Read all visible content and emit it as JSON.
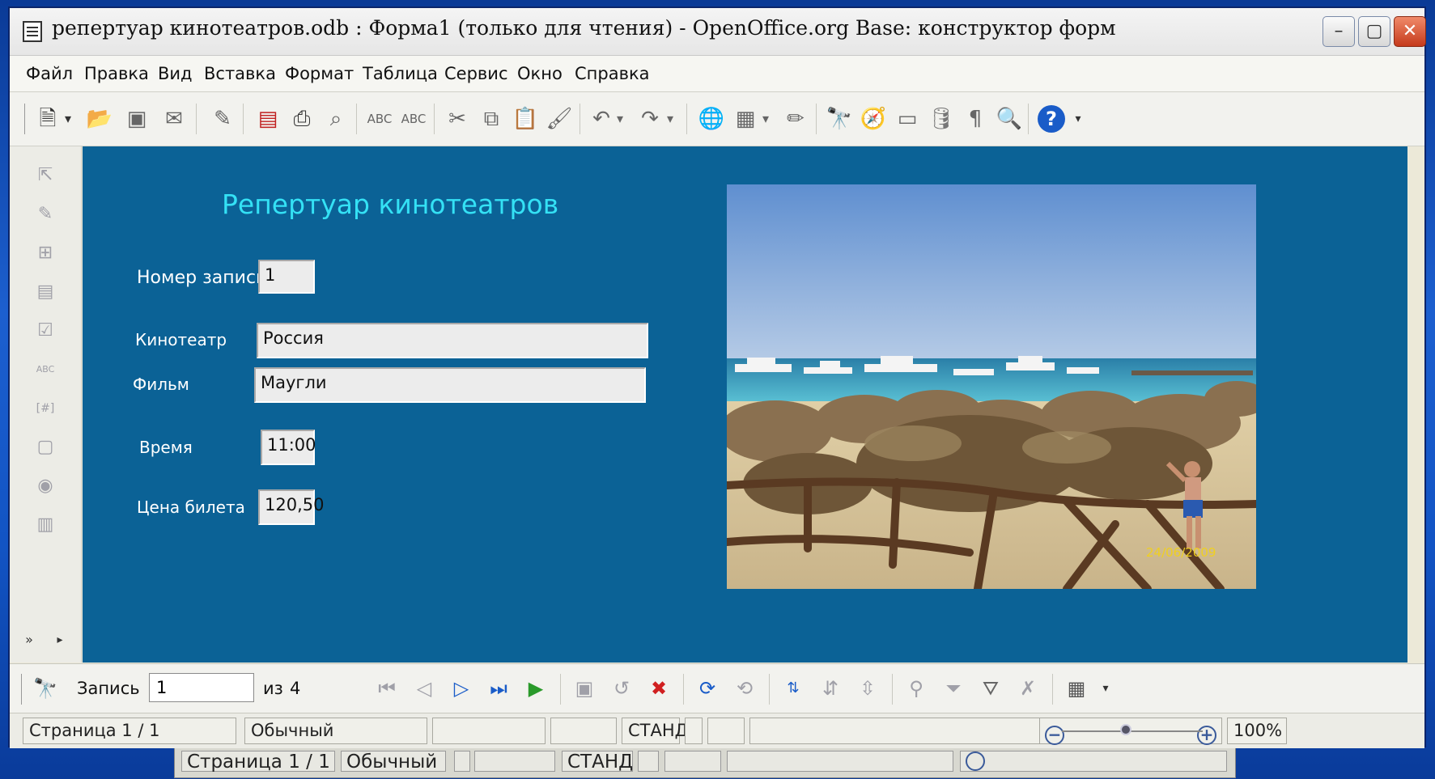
{
  "window": {
    "title": "репертуар кинотеатров.odb : Форма1 (только для чтения) - OpenOffice.org Base: конструктор форм",
    "minimize": "–",
    "maximize": "▢",
    "close": "✕"
  },
  "menu": [
    "Файл",
    "Правка",
    "Вид",
    "Вставка",
    "Формат",
    "Таблица",
    "Сервис",
    "Окно",
    "Справка"
  ],
  "form": {
    "title": "Репертуар кинотеатров",
    "fields": [
      {
        "label": "Номер записи",
        "value": "1"
      },
      {
        "label": "Кинотеатр",
        "value": "Россия"
      },
      {
        "label": "Фильм",
        "value": "Маугли"
      },
      {
        "label": "Время",
        "value": "11:00"
      },
      {
        "label": "Цена билета",
        "value": "120,50"
      }
    ],
    "photo_date": "24/06/2009"
  },
  "nav": {
    "record_label": "Запись",
    "record_value": "1",
    "of_label": "из",
    "total": "4"
  },
  "status": {
    "page": "Страница  1 / 1",
    "style": "Обычный",
    "mode": "СТАНД",
    "zoom": "100%"
  },
  "background_status": {
    "page": "Страница  1 / 1",
    "style": "Обычный",
    "mode": "СТАНД"
  },
  "colors": {
    "form_background": "#0b6296",
    "form_title": "#34e1f5",
    "label_text": "#ffffff"
  }
}
